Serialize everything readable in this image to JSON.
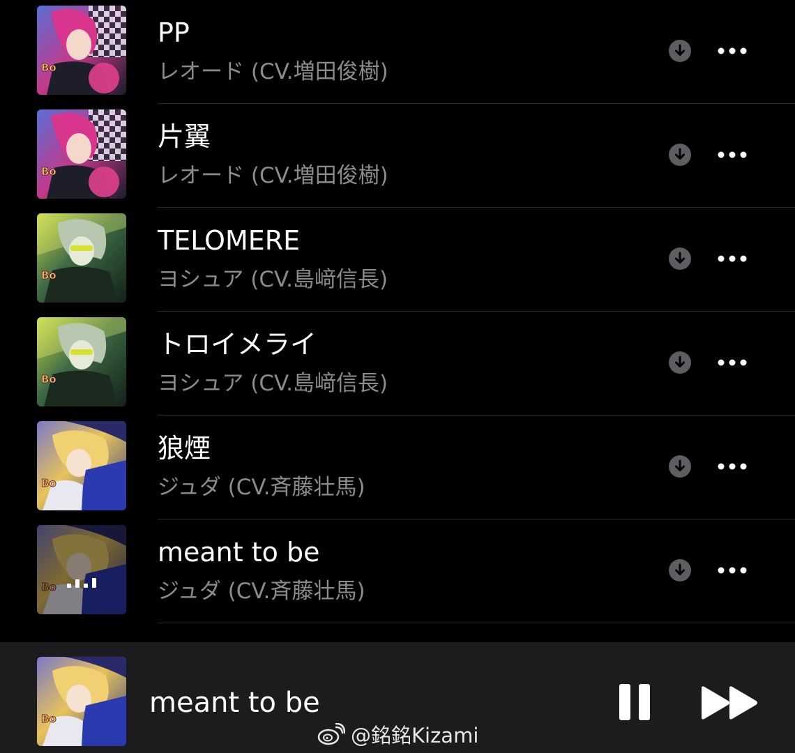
{
  "colors": {
    "background": "#000000",
    "title_text": "#ffffff",
    "subtitle_text": "#8c8c8e",
    "separator": "#2a2a2c",
    "player_bar": "#1c1c1e",
    "icon_gray": "#5e5e62"
  },
  "tracks": [
    {
      "title": "PP",
      "artist": "レオード (CV.増田俊樹)",
      "artwork": "magenta-hair-character-art",
      "download_icon": "cloud-download-icon",
      "more_icon": "ellipsis-icon"
    },
    {
      "title": "片翼",
      "artist": "レオード (CV.増田俊樹)",
      "artwork": "magenta-hair-character-art",
      "download_icon": "cloud-download-icon",
      "more_icon": "ellipsis-icon"
    },
    {
      "title": "TELOMERE",
      "artist": "ヨシュア (CV.島﨑信長)",
      "artwork": "green-hair-character-art",
      "download_icon": "cloud-download-icon",
      "more_icon": "ellipsis-icon"
    },
    {
      "title": "トロイメライ",
      "artist": "ヨシュア (CV.島﨑信長)",
      "artwork": "green-hair-character-art",
      "download_icon": "cloud-download-icon",
      "more_icon": "ellipsis-icon"
    },
    {
      "title": "狼煙",
      "artist": "ジュダ (CV.斉藤壮馬)",
      "artwork": "blonde-hair-character-art",
      "download_icon": "cloud-download-icon",
      "more_icon": "ellipsis-icon"
    },
    {
      "title": "meant to be",
      "artist": "ジュダ (CV.斉藤壮馬)",
      "artwork": "blonde-hair-character-art",
      "download_icon": "cloud-download-icon",
      "more_icon": "ellipsis-icon",
      "now_playing_indicator": "equalizer-bars-icon"
    }
  ],
  "now_playing": {
    "title": "meant to be",
    "artwork": "blonde-hair-character-art",
    "pause_icon": "pause-icon",
    "forward_icon": "fast-forward-icon"
  },
  "watermark": {
    "icon": "weibo-logo-icon",
    "text": "@銘銘Kizami"
  }
}
